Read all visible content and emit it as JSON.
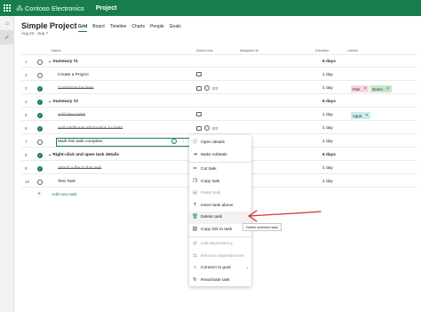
{
  "topbar": {
    "brand": "Contoso Electronics",
    "app": "Project",
    "brand_color": "#177e4b"
  },
  "project": {
    "title": "Simple Project",
    "dates": "Aug 22 - Sep 7"
  },
  "tabs": [
    {
      "label": "Grid",
      "active": true
    },
    {
      "label": "Board"
    },
    {
      "label": "Timeline"
    },
    {
      "label": "Charts"
    },
    {
      "label": "People"
    },
    {
      "label": "Goals"
    }
  ],
  "columns": {
    "name": "Name",
    "quick_look": "Quick look",
    "assigned": "Assigned to",
    "duration": "Duration",
    "labels": "Labels"
  },
  "rows": [
    {
      "num": "1",
      "name": "Summary #1",
      "summary": true,
      "done": false,
      "duration": "6 days"
    },
    {
      "num": "2",
      "name": "Create a Project",
      "summary": false,
      "done": false,
      "duration": "1 day",
      "quicklook": "note"
    },
    {
      "num": "3",
      "name": "Customize buckets",
      "summary": false,
      "done": true,
      "duration": "1 day",
      "quicklook": "note-check",
      "checklist": "0/3",
      "labels": [
        {
          "text": "Pink",
          "color": "pink"
        },
        {
          "text": "Green",
          "color": "green"
        }
      ]
    },
    {
      "num": "4",
      "name": "Summary #2",
      "summary": true,
      "done": true,
      "duration": "6 days"
    },
    {
      "num": "5",
      "name": "Add new tasks",
      "summary": false,
      "done": true,
      "duration": "1 day",
      "quicklook": "note",
      "labels": [
        {
          "text": "Aqua",
          "color": "aqua"
        }
      ]
    },
    {
      "num": "6",
      "name": "Add additional information to tasks",
      "summary": false,
      "done": true,
      "duration": "1 day",
      "quicklook": "note-check",
      "checklist": "0/3"
    },
    {
      "num": "7",
      "name": "Mark this task complete",
      "summary": false,
      "done": false,
      "selected": true,
      "duration": "1 day"
    },
    {
      "num": "8",
      "name": "Right-click and open task details",
      "summary": true,
      "done": true,
      "duration": "6 days"
    },
    {
      "num": "9",
      "name": "Attach a file to this task",
      "summary": false,
      "done": true,
      "duration": "1 day"
    },
    {
      "num": "10",
      "name": "Test Task",
      "summary": false,
      "done": false,
      "duration": "1 day"
    }
  ],
  "add_task": "Add new task",
  "context_menu": {
    "items": [
      {
        "label": "Open details",
        "icon": "info-icon",
        "disabled": false
      },
      {
        "label": "Make subtask",
        "icon": "subtask-icon",
        "disabled": false
      },
      {
        "label": "Cut task",
        "icon": "scissors-icon",
        "disabled": false
      },
      {
        "label": "Copy task",
        "icon": "copy-icon",
        "disabled": false
      },
      {
        "label": "Paste task",
        "icon": "paste-icon",
        "disabled": true
      },
      {
        "label": "Insert task above",
        "icon": "insert-above-icon",
        "disabled": false
      },
      {
        "label": "Delete task",
        "icon": "trash-icon",
        "disabled": false
      },
      {
        "label": "Copy link to task",
        "icon": "link-icon",
        "disabled": false
      },
      {
        "label": "Add dependency",
        "icon": "dependency-icon",
        "disabled": true
      },
      {
        "label": "Remove dependencies",
        "icon": "remove-dependency-icon",
        "disabled": true
      },
      {
        "label": "Connect to goal",
        "icon": "goal-icon",
        "disabled": false,
        "submenu": true
      },
      {
        "label": "Reactivate task",
        "icon": "reactivate-icon",
        "disabled": false
      }
    ]
  },
  "tooltip": "Delete selected task",
  "annotation_color": "#d13438"
}
